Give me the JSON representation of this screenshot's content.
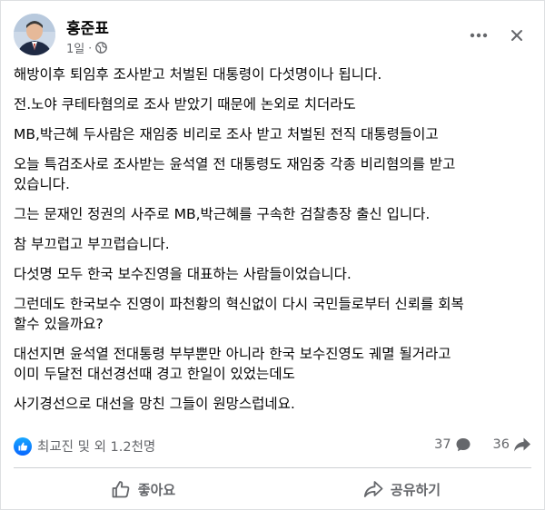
{
  "post": {
    "author": "홍준표",
    "time": "1일",
    "privacy_icon": "globe-icon",
    "more_icon": "more-horizontal-icon",
    "close_icon": "close-icon",
    "paragraphs": [
      "해방이후 퇴임후 조사받고 처벌된 대통령이 다섯명이나 됩니다.",
      "전.노야 쿠테타혐의로 조사 받았기 때문에 논외로 치더라도",
      "MB,박근혜 두사람은 재임중 비리로 조사 받고 처벌된 전직 대통령들이고",
      "오늘 특검조사로 조사받는 윤석열 전 대통령도 재임중 각종 비리혐의를 받고\n있습니다.",
      "그는 문재인 정권의 사주로 MB,박근혜를 구속한 검찰총장 출신 입니다.",
      "참 부끄럽고 부끄럽습니다.",
      "다섯명 모두 한국 보수진영을 대표하는 사람들이었습니다.",
      "그런데도 한국보수 진영이 파천황의 혁신없이 다시 국민들로부터 신뢰를 회복\n할수 있을까요?",
      "대선지면 윤석열 전대통령 부부뿐만 아니라 한국 보수진영도 궤멸 될거라고\n이미 두달전 대선경선때 경고 한일이 있었는데도",
      "사기경선으로 대선을 망친 그들이 원망스럽네요."
    ]
  },
  "stats": {
    "reactions_text": "최교진 및 외 1.2천명",
    "comments_count": "37",
    "shares_count": "36"
  },
  "actions": {
    "like_label": "좋아요",
    "share_label": "공유하기"
  },
  "colors": {
    "like_blue": "#0866ff",
    "secondary_text": "#65676b",
    "divider": "#ced0d4"
  }
}
